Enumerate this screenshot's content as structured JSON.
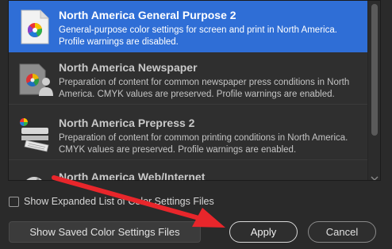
{
  "list": {
    "items": [
      {
        "title": "North America General Purpose 2",
        "desc": "General-purpose color settings for screen and print in North America. Profile warnings are disabled.",
        "icon": "document-color-wheel-icon",
        "selected": true
      },
      {
        "title": "North America Newspaper",
        "desc": "Preparation of content for common newspaper press conditions in North America. CMYK values are preserved. Profile warnings are enabled.",
        "icon": "newspaper-person-icon",
        "selected": false
      },
      {
        "title": "North America Prepress 2",
        "desc": "Preparation of content for common printing conditions in North America. CMYK values are preserved. Profile warnings are enabled.",
        "icon": "printing-press-icon",
        "selected": false
      },
      {
        "title": "North America Web/Internet",
        "desc": "",
        "icon": "globe-icon",
        "selected": false
      }
    ]
  },
  "expanded_list": {
    "label": "Show Expanded List of Color Settings Files",
    "checked": false
  },
  "buttons": {
    "saved": "Show Saved Color Settings Files",
    "apply": "Apply",
    "cancel": "Cancel"
  },
  "annotation": {
    "arrow_color": "#e8262b"
  },
  "colors": {
    "selection": "#2f6ed6",
    "background": "#2a2a2a"
  }
}
